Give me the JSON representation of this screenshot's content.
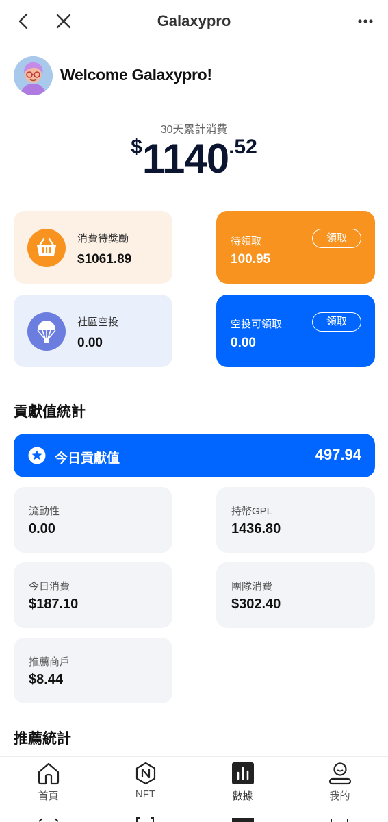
{
  "header": {
    "title": "Galaxypro"
  },
  "welcome": {
    "text": "Welcome Galaxypro!"
  },
  "summary": {
    "label": "30天累計消費",
    "currency": "$",
    "amount_int": "1140",
    "amount_dec": ".52"
  },
  "cards": {
    "consumption_reward": {
      "label": "消費待獎勵",
      "value": "$1061.89"
    },
    "pending_claim": {
      "label": "待領取",
      "value": "100.95",
      "button": "領取"
    },
    "community_airdrop": {
      "label": "社區空投",
      "value": "0.00"
    },
    "airdrop_claimable": {
      "label": "空投可領取",
      "value": "0.00",
      "button": "領取"
    }
  },
  "contribution": {
    "section_title": "貢獻值統計",
    "today": {
      "label": "今日貢獻值",
      "value": "497.94"
    },
    "stats": [
      {
        "label": "流動性",
        "value": "0.00"
      },
      {
        "label": "持幣GPL",
        "value": "1436.80"
      },
      {
        "label": "今日消費",
        "value": "$187.10"
      },
      {
        "label": "團隊消費",
        "value": "$302.40"
      },
      {
        "label": "推薦商戶",
        "value": "$8.44"
      }
    ]
  },
  "referral": {
    "section_title": "推薦統計"
  },
  "nav": {
    "items": [
      {
        "label": "首頁",
        "icon": "home-icon"
      },
      {
        "label": "NFT",
        "icon": "nft-icon"
      },
      {
        "label": "數據",
        "icon": "data-chart-icon",
        "active": true
      },
      {
        "label": "我的",
        "icon": "profile-icon"
      }
    ]
  },
  "colors": {
    "orange": "#f7931e",
    "blue": "#0066ff",
    "purple": "#6c7de0",
    "cream": "#fdf1e6",
    "light_blue": "#e9f0fb",
    "stat_bg": "#f2f4f7"
  }
}
